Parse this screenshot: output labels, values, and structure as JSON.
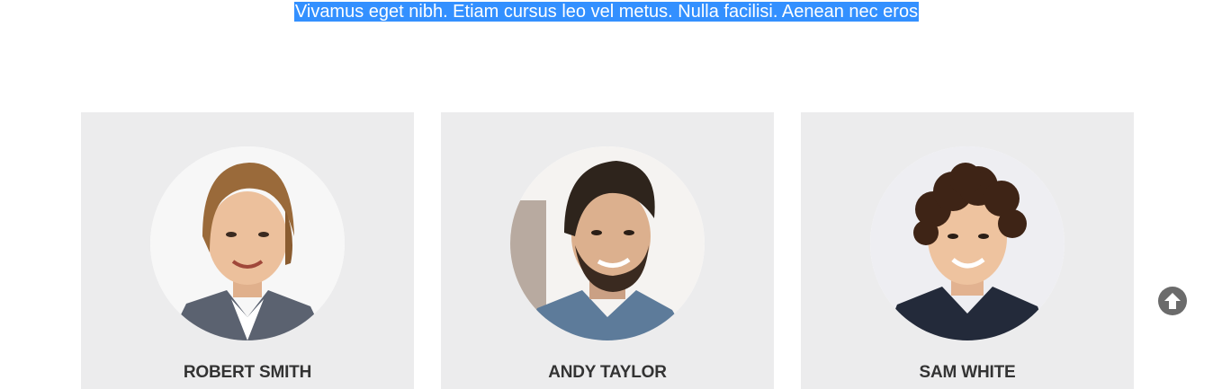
{
  "intro": {
    "text": "Vivamus eget nibh. Etiam cursus leo vel metus. Nulla facilisi. Aenean nec eros"
  },
  "team": [
    {
      "name": "ROBERT SMITH"
    },
    {
      "name": "ANDY TAYLOR"
    },
    {
      "name": "SAM WHITE"
    }
  ],
  "icons": {
    "scroll_top": "arrow-circle-up-icon"
  },
  "colors": {
    "selection_highlight": "#3390ff",
    "card_background": "#ececed",
    "name_text": "#333333",
    "scroll_button": "#6b6b6b"
  }
}
